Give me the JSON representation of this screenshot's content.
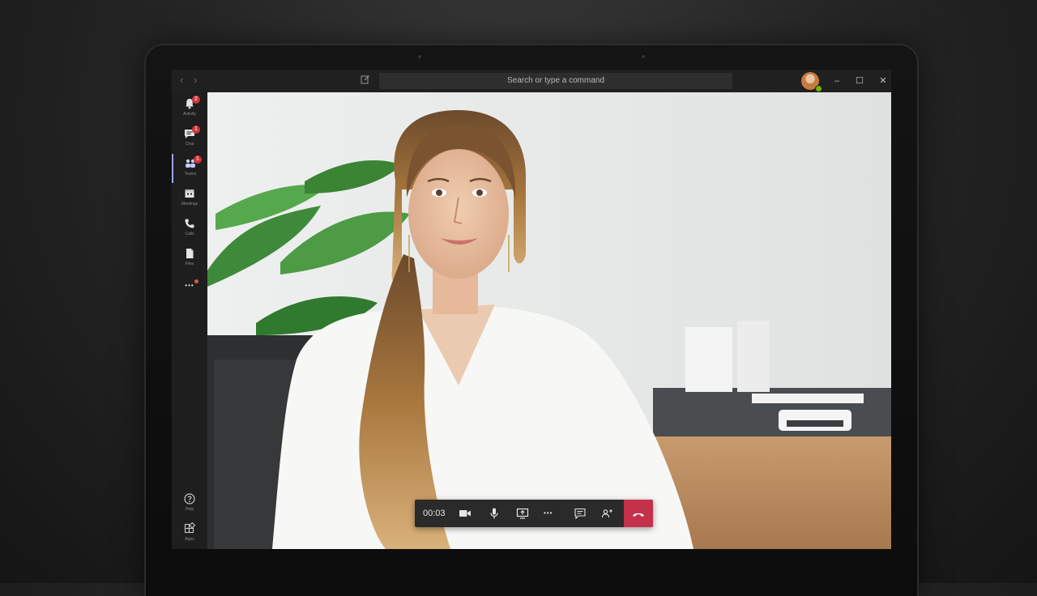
{
  "titlebar": {
    "search_placeholder": "Search or type a command",
    "back_icon": "chevron-left-icon",
    "forward_icon": "chevron-right-icon",
    "compose_icon": "compose-icon",
    "minimize_glyph": "–",
    "maximize_glyph": "☐",
    "close_glyph": "✕"
  },
  "rail": {
    "items": [
      {
        "label": "Activity",
        "icon": "bell-icon",
        "badge": "2"
      },
      {
        "label": "Chat",
        "icon": "chat-icon",
        "badge": "1"
      },
      {
        "label": "Teams",
        "icon": "teams-icon",
        "badge": "1"
      },
      {
        "label": "Meetings",
        "icon": "calendar-icon",
        "badge": ""
      },
      {
        "label": "Calls",
        "icon": "phone-icon",
        "badge": ""
      },
      {
        "label": "Files",
        "icon": "file-icon",
        "badge": ""
      }
    ],
    "more_glyph": "•••",
    "bottom": [
      {
        "label": "Help",
        "icon": "help-icon"
      },
      {
        "label": "Apps",
        "icon": "apps-icon"
      }
    ]
  },
  "call": {
    "timer": "00:03",
    "more_glyph": "•••",
    "hangup_color": "#c4314b"
  },
  "colors": {
    "accent": "#9ea2ff",
    "badge": "#d13438",
    "presence": "#6bb700"
  }
}
